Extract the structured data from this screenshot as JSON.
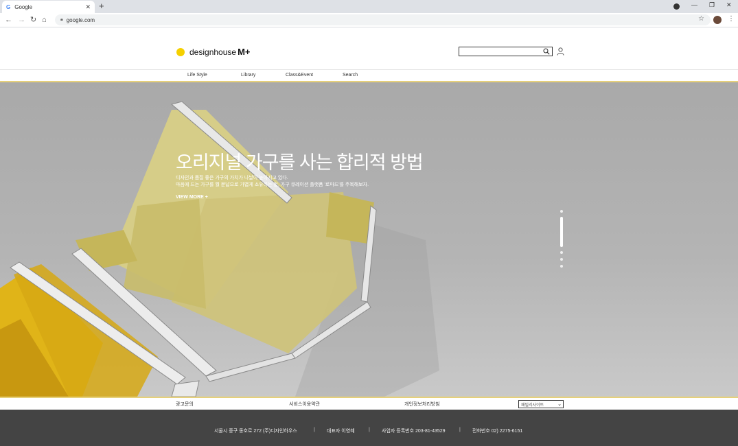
{
  "browser": {
    "tab_title": "Google",
    "tab_icon_letter": "G",
    "tab_close": "✕",
    "new_tab": "+",
    "url": "google.com",
    "minimize": "—",
    "restore": "❐",
    "close": "✕"
  },
  "site": {
    "logo_text": "designhouse",
    "logo_mark": "M+",
    "search_placeholder": "",
    "nav": [
      "Life Style",
      "Library",
      "Class&Event",
      "Search"
    ]
  },
  "hero": {
    "title": "오리지널 가구를 사는 합리적 방법",
    "desc_line1": "디자인과 품질 좋은 가구의 가치가 나날이 높아지고 있다.",
    "desc_line2": "마음에 드는 가구를 월 분납으로 가볍게 소유하는 법, 가구 큐레이션 플랫폼 '로마드'를 주목해보자.",
    "view_more": "VIEW MORE +",
    "slide_count": 6,
    "active_slide": 1
  },
  "footer_links": {
    "ad": "광고문의",
    "terms": "서비스이용약관",
    "privacy": "개인정보처리방침",
    "family_site_selected": "패밀리사이트"
  },
  "footer_info": {
    "address": "서울시 중구 동호로 272 (주)디자인하우스",
    "ceo": "대표자 이영혜",
    "biz_no": "사업자 등록번호 203-81-43529",
    "phone": "전화번호 02) 2275-6151",
    "separator": "|"
  },
  "colors": {
    "brand_yellow": "#f5d000",
    "accent_line": "#e6d07a",
    "footer_bg": "#444444"
  }
}
